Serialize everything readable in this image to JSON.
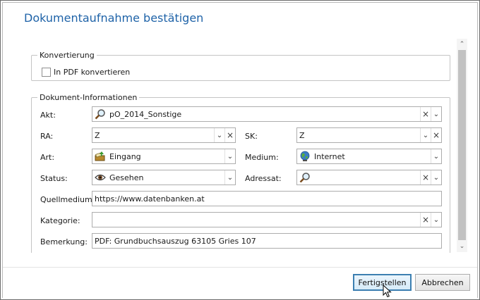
{
  "dialog": {
    "title": "Dokumentaufnahme bestätigen"
  },
  "konvertierung": {
    "legend": "Konvertierung",
    "pdf_checkbox_label": "In PDF konvertieren",
    "pdf_checked": false
  },
  "info": {
    "legend": "Dokument-Informationen",
    "akt": {
      "label": "Akt:",
      "value": "pO_2014_Sonstige",
      "icon": "search-icon"
    },
    "ra": {
      "label": "RA:",
      "value": "Z"
    },
    "sk": {
      "label": "SK:",
      "value": "Z"
    },
    "art": {
      "label": "Art:",
      "value": "Eingang",
      "icon": "inbox-icon"
    },
    "medium": {
      "label": "Medium:",
      "value": "Internet",
      "icon": "globe-icon"
    },
    "status": {
      "label": "Status:",
      "value": "Gesehen",
      "icon": "eye-icon"
    },
    "adressat": {
      "label": "Adressat:",
      "value": "",
      "icon": "search-icon"
    },
    "quellmedium": {
      "label": "Quellmedium:",
      "value": "https://www.datenbanken.at"
    },
    "kategorie": {
      "label": "Kategorie:",
      "value": ""
    },
    "bemerkung": {
      "label": "Bemerkung:",
      "value": "PDF: Grundbuchsauszug 63105 Gries 107"
    }
  },
  "buttons": {
    "finish": "Fertigstellen",
    "cancel": "Abbrechen"
  },
  "glyphs": {
    "dropdown": "⌄",
    "clear": "×",
    "scroll_up": "⌃",
    "scroll_down": "⌄"
  },
  "colors": {
    "title": "#1f63a8",
    "primary_button_border": "#3c7fb1"
  }
}
